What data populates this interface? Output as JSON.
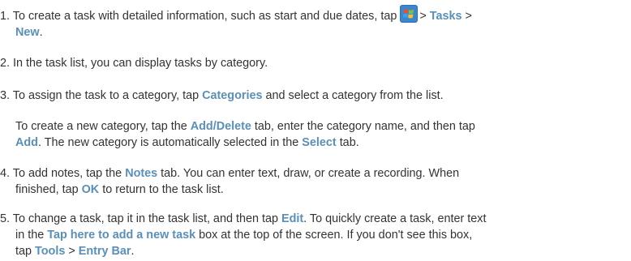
{
  "steps": [
    {
      "num": "1.",
      "line1_a": "To create a task with detailed information, such as start and due dates, tap",
      "line1_b": ">",
      "kw_tasks": "Tasks",
      "line1_c": ">",
      "kw_new": "New",
      "line2_end": "."
    },
    {
      "num": "2.",
      "text": "In the task list, you can display tasks by category."
    },
    {
      "num": "3.",
      "a": "To assign the task to a category, tap",
      "kw_categories": "Categories",
      "b": "and select a category from the list."
    },
    {
      "sub_a": "To create a new category, tap the",
      "kw_adddelete": "Add/Delete",
      "sub_b": "tab, enter the category name, and then tap",
      "kw_add": "Add",
      "sub_c": ". The new category is automatically selected in the",
      "kw_select": "Select",
      "sub_d": "tab."
    },
    {
      "num": "4.",
      "a": "To add notes, tap the",
      "kw_notes": "Notes",
      "b": "tab. You can enter text, draw, or create a recording. When",
      "c": "finished, tap",
      "kw_ok": "OK",
      "d": "to return to the task list."
    },
    {
      "num": "5.",
      "a": "To change a task, tap it in the task list, and then tap",
      "kw_edit": "Edit",
      "b": ". To quickly create a task, enter text",
      "c": "in the",
      "kw_taphere": "Tap here to add a new task",
      "d": "box at the top of the screen. If you don't see this box,",
      "e": "tap",
      "kw_tools": "Tools",
      "f": ">",
      "kw_entrybar": "Entry Bar",
      "g": "."
    }
  ],
  "icon": "windows-start-flag-icon",
  "colors": {
    "text": "#333333",
    "keyword": "#5a8fb8"
  }
}
